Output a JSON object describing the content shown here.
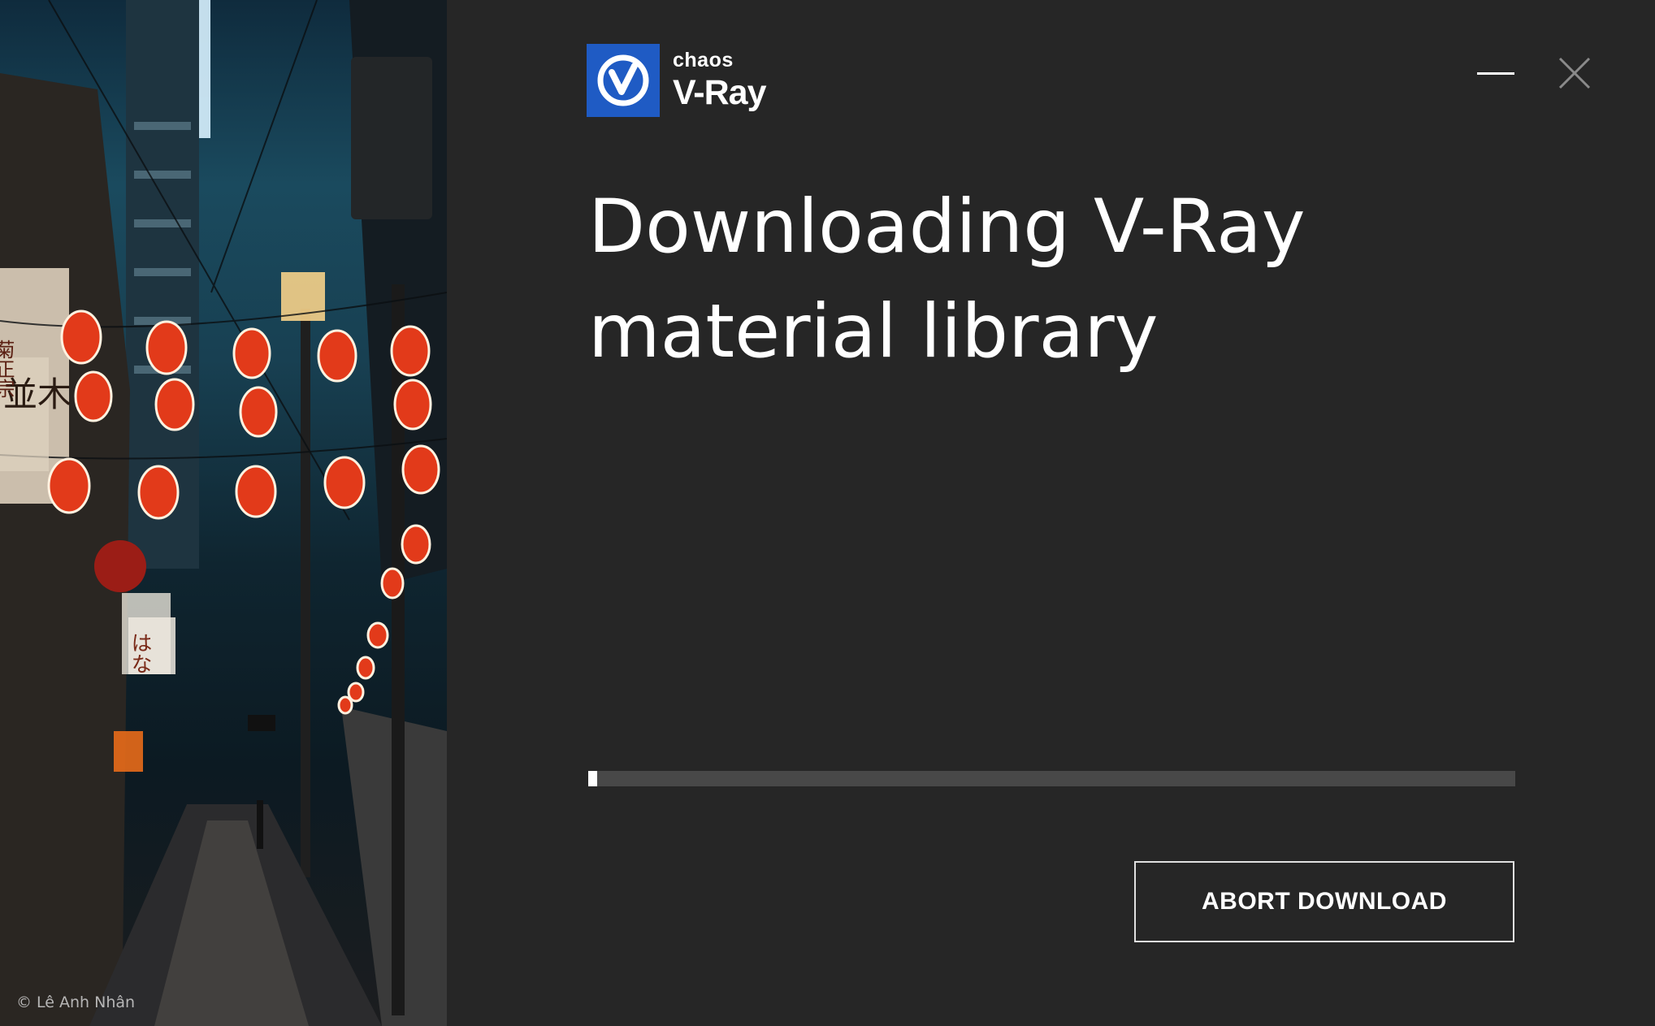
{
  "photo": {
    "credit": "© Lê Anh Nhân",
    "sign_text": [
      "菊正宗",
      "並木",
      "はな"
    ]
  },
  "logo": {
    "brand": "chaos",
    "product": "V-Ray",
    "mark_icon": "vray-v-icon",
    "accent_color": "#1f5bc4"
  },
  "window": {
    "minimize_icon": "minimize-icon",
    "close_icon": "close-icon"
  },
  "main": {
    "title_line1": "Downloading V-Ray",
    "title_line2": "material library"
  },
  "progress": {
    "value": 0.01
  },
  "actions": {
    "abort_label": "ABORT DOWNLOAD"
  }
}
